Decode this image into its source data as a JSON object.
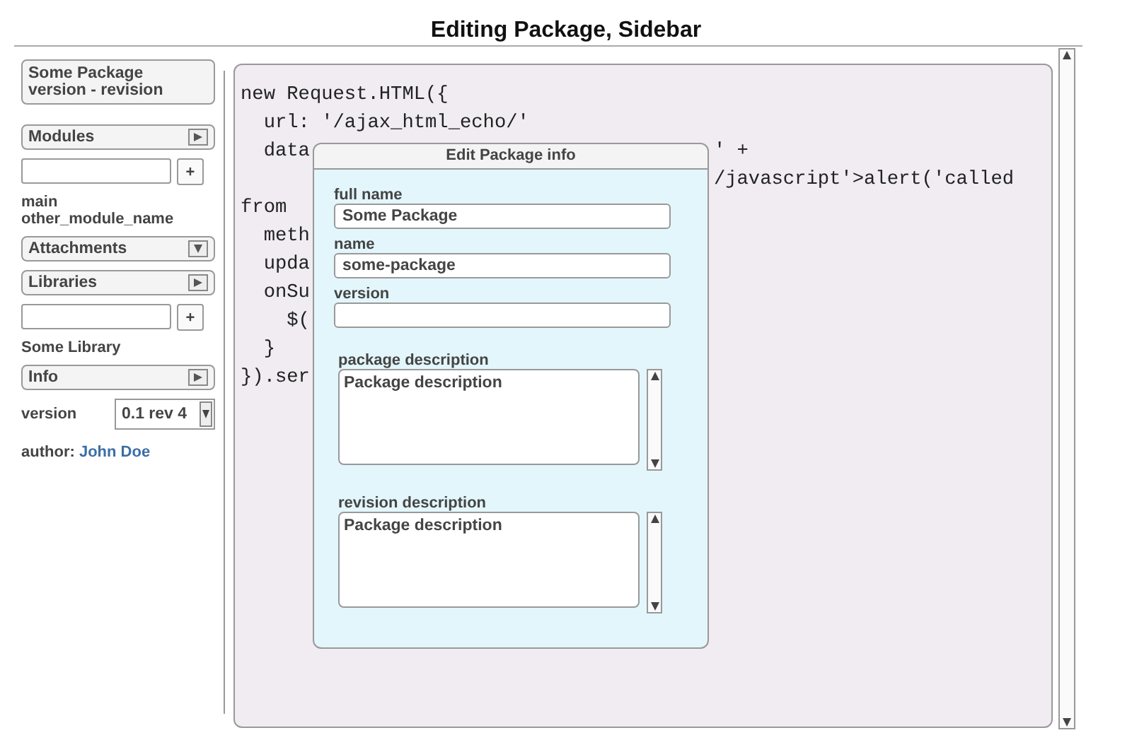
{
  "window": {
    "title": "Editing Package, Sidebar"
  },
  "sidebar": {
    "package": {
      "name": "Some Package",
      "subtitle": "version - revision"
    },
    "sections": [
      {
        "kind": "list",
        "label": "Modules",
        "expanded": true,
        "add": "+",
        "items": [
          "main",
          "other_module_name"
        ]
      },
      {
        "label": "Attachments",
        "expanded": false
      },
      {
        "kind": "list",
        "label": "Libraries",
        "expanded": true,
        "add": "+",
        "items": [
          "Some Library"
        ]
      },
      {
        "kind": "info",
        "label": "Info",
        "expanded": true,
        "version_label": "version",
        "version_value": "0.1 rev 4",
        "author_label": "author:",
        "author": "John Doe"
      }
    ]
  },
  "editor": {
    "lines": [
      {
        "left": "new Request.HTML({"
      },
      {
        "left": "  url: '/ajax_html_echo/'"
      },
      {
        "left": "  data",
        "right": "' +"
      },
      {
        "right": "/javascript'>alert('called"
      },
      {
        "left": "from "
      },
      {
        "left": "  meth"
      },
      {
        "left": "  upda"
      },
      {
        "left": "  onSu"
      },
      {
        "left": "    $("
      },
      {
        "left": "  }"
      },
      {
        "left": "}).ser"
      }
    ]
  },
  "dialog": {
    "title": "Edit Package info",
    "fields": [
      {
        "kind": "input",
        "label": "full name",
        "value": "Some Package"
      },
      {
        "kind": "input",
        "label": "name",
        "value": "some-package"
      },
      {
        "kind": "input",
        "label": "version"
      },
      {
        "kind": "textarea",
        "label": "package description",
        "value": "Package description"
      },
      {
        "kind": "textarea",
        "label": "revision description",
        "value": "Package description"
      }
    ]
  }
}
